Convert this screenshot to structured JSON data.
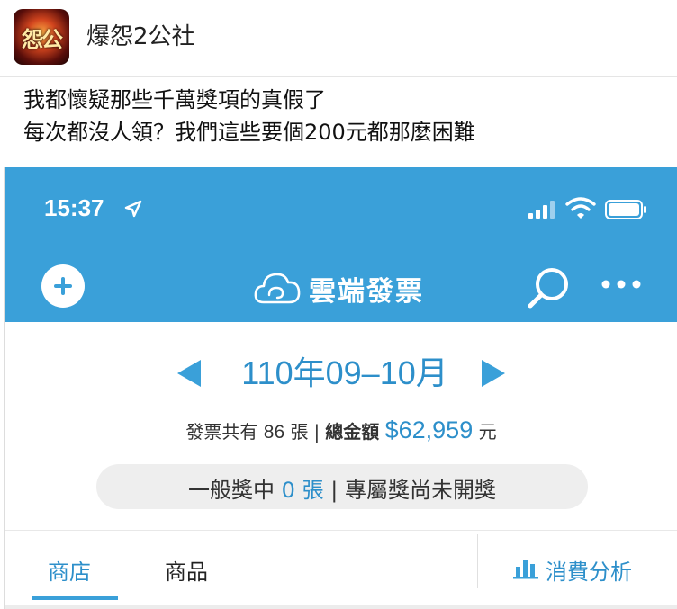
{
  "post": {
    "group_name": "爆怨2公社",
    "avatar_text": "怨公",
    "lines": [
      "我都懷疑那些千萬獎項的真假了",
      "每次都沒人領？我們這些要個200元都那麼困難"
    ]
  },
  "status_bar": {
    "time": "15:37"
  },
  "app": {
    "title": "雲端發票",
    "accent_color": "#3aa0d9",
    "icons": [
      "plus-icon",
      "cloud-icon",
      "search-icon",
      "more-icon"
    ]
  },
  "period": {
    "label": "110年09–10月"
  },
  "summary": {
    "prefix": "發票共有",
    "count": "86",
    "count_unit": "張",
    "sep": "|",
    "total_label": "總金額",
    "amount": "$62,959",
    "currency": "元"
  },
  "prize": {
    "prefix": "一般獎中",
    "count": "0",
    "unit": "張",
    "sep": "|",
    "exclusive": "專屬獎尚未開獎"
  },
  "tabs": {
    "shop": "商店",
    "goods": "商品",
    "analysis": "消費分析"
  }
}
